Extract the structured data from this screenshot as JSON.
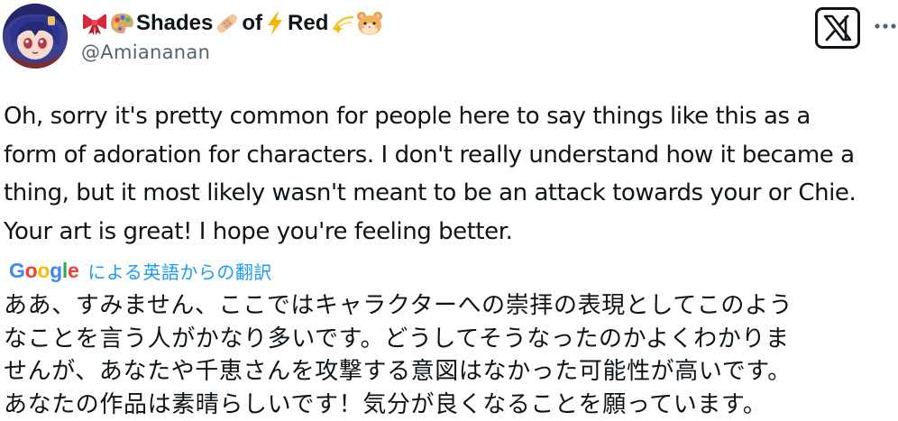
{
  "author": {
    "display_name_parts": [
      {
        "type": "emoji",
        "icon": "ribbon-emoji",
        "glyph": "🎀"
      },
      {
        "type": "emoji",
        "icon": "palette-emoji",
        "glyph": "🎨"
      },
      {
        "type": "text",
        "text": "Shades"
      },
      {
        "type": "emoji",
        "icon": "bandage-emoji",
        "glyph": "🩹"
      },
      {
        "type": "text",
        "text": "of"
      },
      {
        "type": "emoji",
        "icon": "lightning-emoji",
        "glyph": "⚡"
      },
      {
        "type": "text",
        "text": "Red"
      },
      {
        "type": "emoji",
        "icon": "dizzy-emoji",
        "glyph": "💫"
      },
      {
        "type": "emoji",
        "icon": "hamster-emoji",
        "glyph": "🐹"
      }
    ],
    "handle": "@Amiananan",
    "avatar_icon": "anime-avatar"
  },
  "actions": {
    "x_logo_icon": "x-logo-icon",
    "more_icon": "more-options-icon"
  },
  "post": {
    "lines": [
      "Oh, sorry it's pretty common for people here to say things like this as a",
      "form of adoration for characters. I don't really understand how it became a",
      "thing, but it most likely wasn't meant to be an attack towards your or Chie.",
      "Your art is great! I hope you're feeling better."
    ]
  },
  "translation": {
    "provider_name": "Google",
    "label": "による英語からの翻訳",
    "lines": [
      "ああ、すみません、ここではキャラクターへの崇拝の表現としてこのよう",
      "なことを言う人がかなり多いです。どうしてそうなったのかよくわかりま",
      "せんが、あなたや千恵さんを攻撃する意図はなかった可能性が高いです。",
      "あなたの作品は素晴らしいです！気分が良くなることを願っています。"
    ]
  },
  "colors": {
    "text_primary": "#0f1419",
    "text_secondary": "#536471",
    "link_blue": "#1d9bf0"
  }
}
